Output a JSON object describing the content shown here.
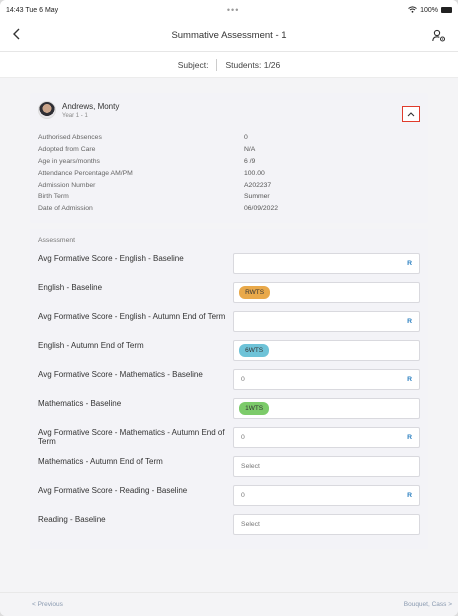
{
  "status_bar": {
    "time": "14:43",
    "date": "Tue 6 May",
    "dots": "•••",
    "battery": "100%"
  },
  "nav": {
    "back_icon": "chevron-left-icon",
    "title": "Summative Assessment - 1",
    "settings_icon": "user-gear-icon"
  },
  "subbar": {
    "subject_label": "Subject:",
    "students_label": "Students: 1/26"
  },
  "student": {
    "name": "Andrews, Monty",
    "year": "Year 1 - 1",
    "collapse_icon": "chevron-up-icon",
    "details": [
      {
        "label": "Authorised Absences",
        "value": "0"
      },
      {
        "label": "Adopted from Care",
        "value": "N/A"
      },
      {
        "label": "Age in years/months",
        "value": "6 /9"
      },
      {
        "label": "Attendance Percentage AM/PM",
        "value": "100.00"
      },
      {
        "label": "Admission Number",
        "value": "A202237"
      },
      {
        "label": "Birth Term",
        "value": "Summer"
      },
      {
        "label": "Date of Admission",
        "value": "06/09/2022"
      }
    ]
  },
  "assessment": {
    "title": "Assessment",
    "rows": [
      {
        "label": "Avg Formative Score - English - Baseline",
        "type": "input",
        "value": "",
        "suffix": "R"
      },
      {
        "label": "English - Baseline",
        "type": "pill",
        "value": "RWTS",
        "color": "#e9a94a"
      },
      {
        "label": "Avg Formative Score - English - Autumn End of Term",
        "type": "input",
        "value": "",
        "suffix": "R"
      },
      {
        "label": "English - Autumn End of Term",
        "type": "pill",
        "value": "6WTS",
        "color": "#6ec3d8"
      },
      {
        "label": "Avg Formative Score - Mathematics - Baseline",
        "type": "input",
        "value": "0",
        "suffix": "R"
      },
      {
        "label": "Mathematics - Baseline",
        "type": "pill",
        "value": "1WTS",
        "color": "#7ccb6a"
      },
      {
        "label": "Avg Formative Score - Mathematics - Autumn End of Term",
        "type": "input",
        "value": "0",
        "suffix": "R"
      },
      {
        "label": "Mathematics - Autumn End of Term",
        "type": "select",
        "value": "Select"
      },
      {
        "label": "Avg Formative Score - Reading - Baseline",
        "type": "input",
        "value": "0",
        "suffix": "R"
      },
      {
        "label": "Reading - Baseline",
        "type": "select",
        "value": "Select"
      }
    ]
  },
  "footer": {
    "previous": "< Previous",
    "next": "Bouquet, Cass >"
  }
}
